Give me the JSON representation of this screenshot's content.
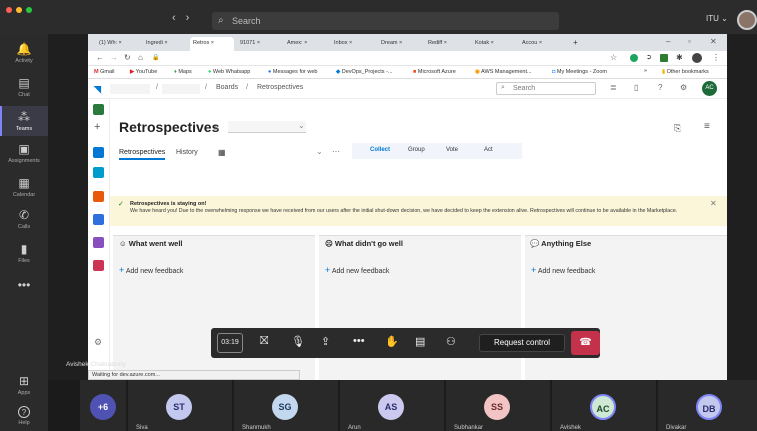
{
  "teams": {
    "search_placeholder": "Search",
    "user_menu": "ITU ⌄",
    "nav_back": "‹",
    "nav_forward": "›"
  },
  "rail": [
    {
      "label": "Activity",
      "icon": "bell-icon",
      "glyph": "🔔"
    },
    {
      "label": "Chat",
      "icon": "chat-icon",
      "glyph": "▤"
    },
    {
      "label": "Teams",
      "icon": "teams-icon",
      "glyph": "⁂"
    },
    {
      "label": "Assignments",
      "icon": "assignments-icon",
      "glyph": "▣"
    },
    {
      "label": "Calendar",
      "icon": "calendar-icon",
      "glyph": "▦"
    },
    {
      "label": "Calls",
      "icon": "calls-icon",
      "glyph": "✆"
    },
    {
      "label": "Files",
      "icon": "files-icon",
      "glyph": "▮"
    },
    {
      "label": "",
      "icon": "more-icon",
      "glyph": "•••"
    }
  ],
  "rail_bottom": [
    {
      "label": "Apps",
      "icon": "apps-icon",
      "glyph": "⊞"
    },
    {
      "label": "Help",
      "icon": "help-icon",
      "glyph": "?"
    }
  ],
  "browser": {
    "tabs": [
      "(1) Wh: ×",
      "Ingredi ×",
      "Retros ×",
      "91071 ×",
      "Amex: ×",
      "Inbox ×",
      "Dream ×",
      "Rediff ×",
      "Kotak ×",
      "Accou ×",
      "+"
    ],
    "bookmarks": [
      "Gmail",
      "YouTube",
      "Maps",
      "Web Whatsapp",
      "Messages for web",
      "DevOps_Projects -...",
      "Microsoft Azure",
      "AWS Management...",
      "My Meetings - Zoom",
      "»",
      "Other bookmarks"
    ]
  },
  "ado": {
    "breadcrumb_sep": "/",
    "breadcrumb_boards": "Boards",
    "breadcrumb_retro": "Retrospectives",
    "search_placeholder": "Search",
    "user_initials": "AC",
    "page_title": "Retrospectives",
    "tabs": [
      "Retrospectives",
      "History"
    ],
    "phases": [
      "Collect",
      "Group",
      "Vote",
      "Act"
    ],
    "banner_title": "Retrospectives is staying on!",
    "banner_text": "We have heard you! Due to the overwhelming response we have received from our users after the initial shut-down decision, we have decided to keep the extension alive. Retrospectives will continue to be available in the Marketplace.",
    "columns": [
      {
        "title": "What went well",
        "icon": "smile-icon",
        "glyph": "☺"
      },
      {
        "title": "What didn't go well",
        "icon": "frown-icon",
        "glyph": "☹"
      },
      {
        "title": "Anything Else",
        "icon": "chat-bubble-icon",
        "glyph": "💬"
      }
    ],
    "add_feedback": "Add new feedback"
  },
  "status": "Waiting for dev.azure.com...",
  "presenter": "Avishek Chakraborty",
  "controls": {
    "timer": "03:19",
    "request_control": "Request control"
  },
  "participants": [
    {
      "initials": "+6",
      "name": "",
      "bg": "#4f52b2",
      "fg": "#ffffff"
    },
    {
      "initials": "ST",
      "name": "Siva",
      "bg": "#c3c8ee",
      "fg": "#2b2d6b"
    },
    {
      "initials": "SG",
      "name": "Shanmukh",
      "bg": "#c3d8ee",
      "fg": "#1d3a5c"
    },
    {
      "initials": "AS",
      "name": "Arun",
      "bg": "#ccc9f0",
      "fg": "#2b2d6b"
    },
    {
      "initials": "SS",
      "name": "Subhankar",
      "bg": "#f2c4c4",
      "fg": "#6b2b2b"
    },
    {
      "initials": "AC",
      "name": "Avishek",
      "bg": "#cfe8d4",
      "fg": "#1c4a2a"
    },
    {
      "initials": "DB",
      "name": "Divakar",
      "bg": "#c3c8ee",
      "fg": "#2b2d6b"
    }
  ]
}
